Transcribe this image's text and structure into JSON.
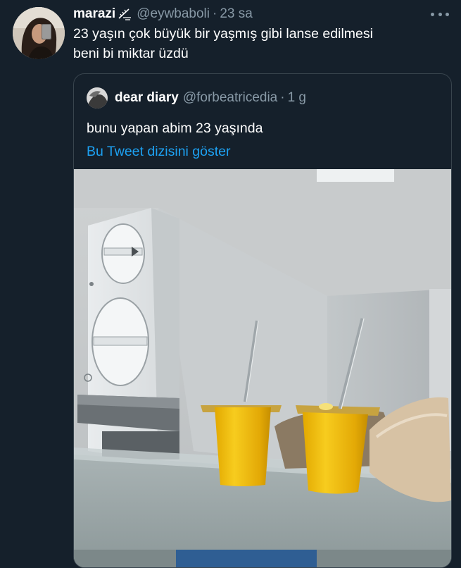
{
  "tweet": {
    "author_name": "marazi",
    "author_emoji": "blowing-feather-icon",
    "handle": "@eywbaboli",
    "separator": "·",
    "time": "23 sa",
    "more_icon": "more-dots-icon",
    "text": "23 yaşın çok büyük bir yaşmış gibi lanse edilmesi\nbeni bi miktar üzdü"
  },
  "quote": {
    "author_name": "dear diary",
    "handle": "@forbeatricedia",
    "separator": "·",
    "time": "1 g",
    "text": "bunu yapan abim 23 yaşında",
    "thread_link": "Bu Tweet dizisini göster"
  },
  "colors": {
    "background": "#15202b",
    "secondary_text": "#8899a6",
    "link": "#1da1f2",
    "border": "#38444d"
  }
}
